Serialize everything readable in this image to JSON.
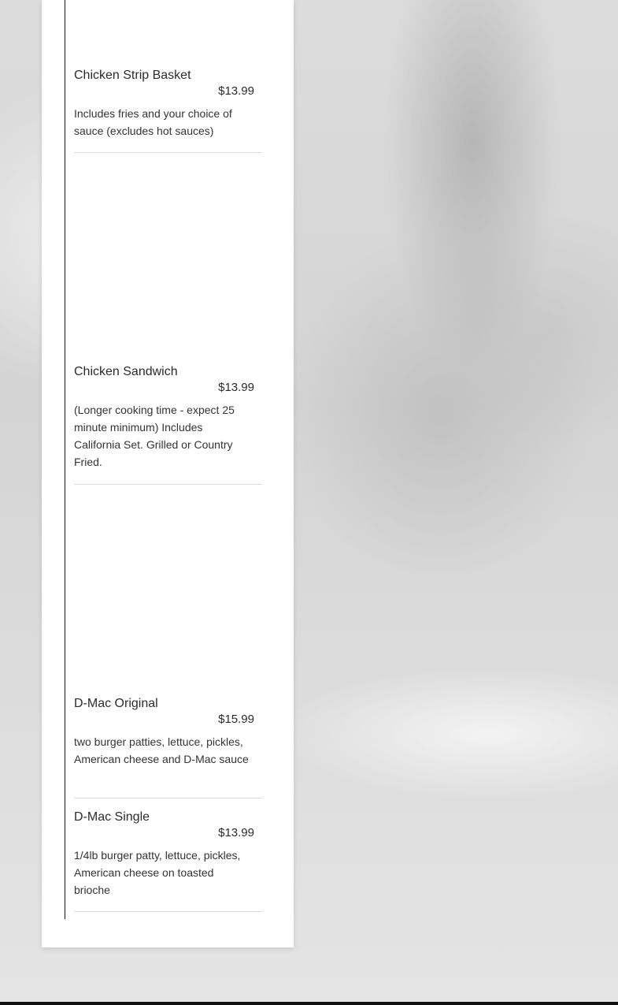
{
  "menu": {
    "items": [
      {
        "name": "Chicken Strip Basket",
        "price": "$13.99",
        "description": "Includes fries and your choice of sauce (excludes hot sauces)"
      },
      {
        "name": "Chicken Sandwich",
        "price": "$13.99",
        "description": "(Longer cooking time - expect 25 minute minimum) Includes California Set. Grilled or Country Fried."
      },
      {
        "name": "D-Mac Original",
        "price": "$15.99",
        "description": "two burger patties, lettuce, pickles, American cheese and D-Mac sauce"
      },
      {
        "name": "D-Mac Single",
        "price": "$13.99",
        "description": "1/4lb burger patty, lettuce, pickles, American cheese on toasted brioche"
      }
    ]
  }
}
